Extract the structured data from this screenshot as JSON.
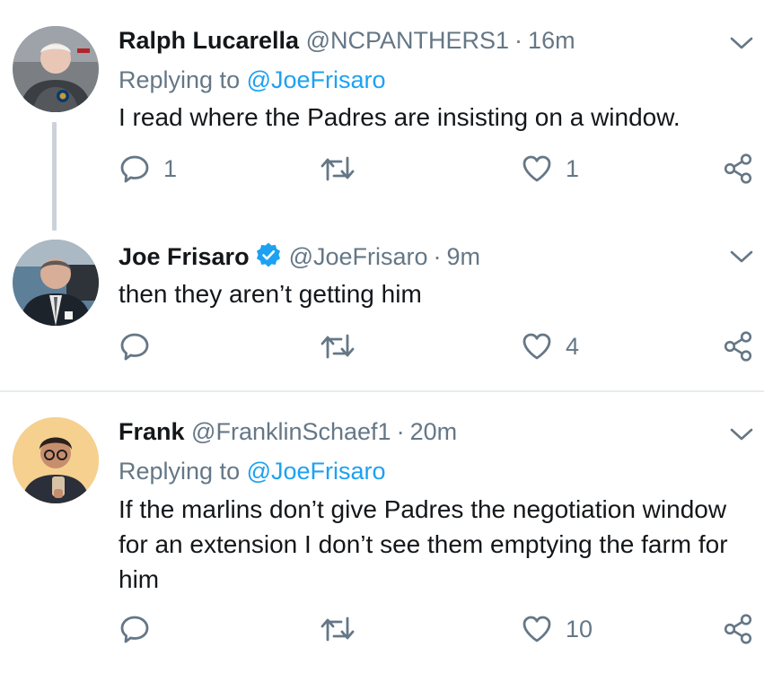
{
  "tweets": [
    {
      "name": "Ralph Lucarella",
      "handle": "@NCPANTHERS1",
      "separator": "·",
      "time": "16m",
      "reply_prefix": "Replying to",
      "reply_mention": "@JoeFrisaro",
      "text": "I read where the Padres are insisting on a window.",
      "reply_count": "1",
      "like_count": "1",
      "verified": false
    },
    {
      "name": "Joe Frisaro",
      "handle": "@JoeFrisaro",
      "separator": "·",
      "time": "9m",
      "text": "then they aren’t getting him",
      "reply_count": "",
      "like_count": "4",
      "verified": true
    },
    {
      "name": "Frank",
      "handle": "@FranklinSchaef1",
      "separator": "·",
      "time": "20m",
      "reply_prefix": "Replying to",
      "reply_mention": "@JoeFrisaro",
      "text": "If the marlins don’t give Padres the negotiation window for an extension I don’t see them emptying the farm for him",
      "reply_count": "",
      "like_count": "10",
      "verified": false
    }
  ],
  "icons": {
    "reply": "reply-icon",
    "retweet": "retweet-icon",
    "like": "heart-icon",
    "share": "share-icon",
    "menu": "chevron-down-icon",
    "verified": "verified-badge-icon"
  },
  "colors": {
    "link": "#1da1f2",
    "secondary_text": "#657786",
    "primary_text": "#14171a",
    "thread_line": "#cbd2d9",
    "divider": "#e6ecf0"
  }
}
